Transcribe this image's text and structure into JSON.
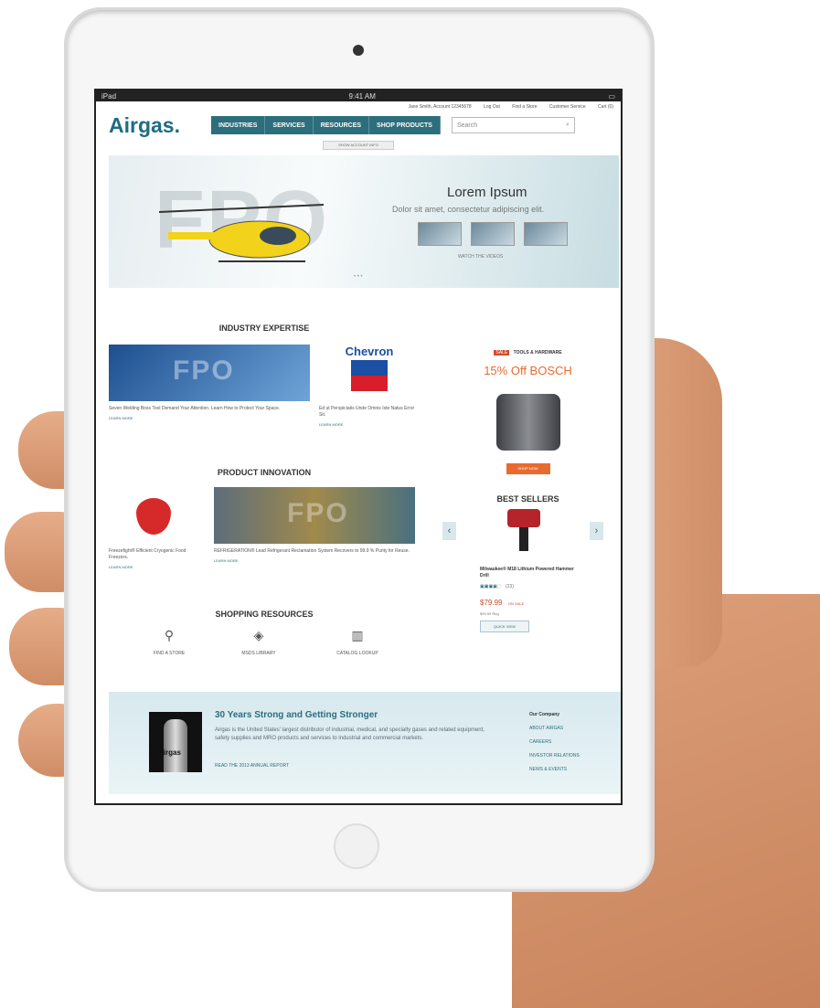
{
  "status": {
    "device": "iPad",
    "time": "9:41 AM"
  },
  "util_links": [
    "Jane Smith, Account 12345678",
    "Log Out",
    "Find a Store",
    "Customer Service",
    "Cart (0)"
  ],
  "logo": "Airgas.",
  "nav": [
    "INDUSTRIES",
    "SERVICES",
    "RESOURCES",
    "SHOP PRODUCTS"
  ],
  "search": {
    "placeholder": "Search"
  },
  "account_menu": "SHOW ACCOUNT INFO",
  "hero": {
    "watermark": "FPO",
    "title": "Lorem Ipsum",
    "subtitle": "Dolor sit amet, consectetur adipiscing elit.",
    "watch": "WATCH THE VIDEOS",
    "dots": "• • •"
  },
  "industry": {
    "title": "INDUSTRY EXPERTISE",
    "items": [
      {
        "caption": "Seven Welding Boss Tool Demand Your Attention. Learn How to Protect Your Space.",
        "learn": "LEARN MORE"
      },
      {
        "logo": "Chevron",
        "caption": "Ed ut Perspiciatis Unde Omnis Iste Natus Error Sit.",
        "learn": "LEARN MORE"
      }
    ]
  },
  "innovation": {
    "title": "PRODUCT INNOVATION",
    "items": [
      {
        "caption": "Freezefight® Efficient Cryogenic Food Freezers.",
        "learn": "LEARN MORE"
      },
      {
        "caption": "REFRIGERATION® Lead Refrigerant Reclamation System Recovers to 99.9 % Purity for Reuse.",
        "learn": "LEARN MORE"
      }
    ]
  },
  "resources": {
    "title": "SHOPPING RESOURCES",
    "items": [
      {
        "label": "FIND A STORE",
        "icon": "location-pin-icon"
      },
      {
        "label": "MSDS LIBRARY",
        "icon": "tag-icon"
      },
      {
        "label": "CATALOG LOOKUP",
        "icon": "open-book-icon"
      }
    ]
  },
  "promo": {
    "badge": "SALE",
    "category": "TOOLS & HARDWARE",
    "title": "15% Off BOSCH",
    "button": "SHOP NOW"
  },
  "best_sellers": {
    "title": "BEST SELLERS",
    "product": "Milwaukee® M18 Lithium Powered Hammer Drill",
    "reviews": "(23)",
    "price": "$79.99",
    "sale": "ON SALE",
    "was": "$99.99 Reg",
    "button": "QUICK VIEW",
    "rating": 4
  },
  "footer": {
    "title": "30 Years Strong and Getting Stronger",
    "text": "Airgas is the United States' largest distributor of industrial, medical, and specialty gases and related equipment, safety supplies and MRO products and services to industrial and commercial markets.",
    "link": "READ THE 2013 ANNUAL REPORT",
    "company_title": "Our Company",
    "company_links": [
      "ABOUT AIRGAS",
      "CAREERS",
      "INVESTOR RELATIONS",
      "NEWS & EVENTS"
    ],
    "cylinder_label": "Airgas"
  },
  "colors": {
    "brand": "#2c6e7c",
    "accent": "#e76b2f",
    "sale": "#d24a2a"
  }
}
